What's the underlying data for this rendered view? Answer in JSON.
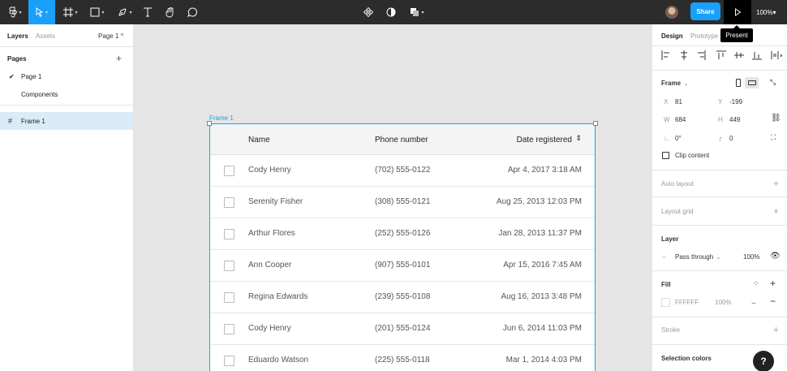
{
  "toolbar": {
    "share_label": "Share",
    "zoom_label": "100%",
    "present_tooltip": "Present",
    "tools": [
      "main-menu",
      "move",
      "frame",
      "shape",
      "pen",
      "text",
      "hand",
      "comment"
    ]
  },
  "left_panel": {
    "tabs": {
      "layers": "Layers",
      "assets": "Assets"
    },
    "page_selector": "Page 1 ^",
    "pages_title": "Pages",
    "pages": [
      "Page 1",
      "Components"
    ],
    "layers": [
      "Frame 1"
    ]
  },
  "canvas": {
    "frame_label": "Frame 1",
    "table": {
      "headers": {
        "name": "Name",
        "phone": "Phone number",
        "date": "Date registered"
      },
      "rows": [
        {
          "name": "Cody Henry",
          "phone": "(702) 555-0122",
          "date": "Apr 4, 2017 3:18 AM"
        },
        {
          "name": "Serenity Fisher",
          "phone": "(308) 555-0121",
          "date": "Aug 25, 2013 12:03 PM"
        },
        {
          "name": "Arthur Flores",
          "phone": "(252) 555-0126",
          "date": "Jan 28, 2013 11:37 PM"
        },
        {
          "name": "Ann Cooper",
          "phone": "(907) 555-0101",
          "date": "Apr 15, 2016 7:45 AM"
        },
        {
          "name": "Regina Edwards",
          "phone": "(239) 555-0108",
          "date": "Aug 16, 2013 3:48 PM"
        },
        {
          "name": "Cody Henry",
          "phone": "(201) 555-0124",
          "date": "Jun 6, 2014 11:03 PM"
        },
        {
          "name": "Eduardo Watson",
          "phone": "(225) 555-0118",
          "date": "Mar 1, 2014 4:03 PM"
        }
      ]
    }
  },
  "right_panel": {
    "tabs": {
      "design": "Design",
      "prototype": "Prototype"
    },
    "frame_title": "Frame",
    "x_label": "X",
    "x_value": "81",
    "y_label": "Y",
    "y_value": "-199",
    "w_label": "W",
    "w_value": "684",
    "h_label": "H",
    "h_value": "449",
    "rotation": "0°",
    "radius": "0",
    "clip_content": "Clip content",
    "auto_layout": "Auto layout",
    "layout_grid": "Layout grid",
    "layer_title": "Layer",
    "blend_mode": "Pass through",
    "layer_opacity": "100%",
    "fill_title": "Fill",
    "fill_hex": "FFFFFF",
    "fill_opacity": "100%",
    "stroke_title": "Stroke",
    "selection_colors": "Selection colors",
    "help_label": "?"
  },
  "colors": {
    "accent": "#18a0fb",
    "toolbar": "#2c2c2c",
    "selection": "#daebf7"
  }
}
